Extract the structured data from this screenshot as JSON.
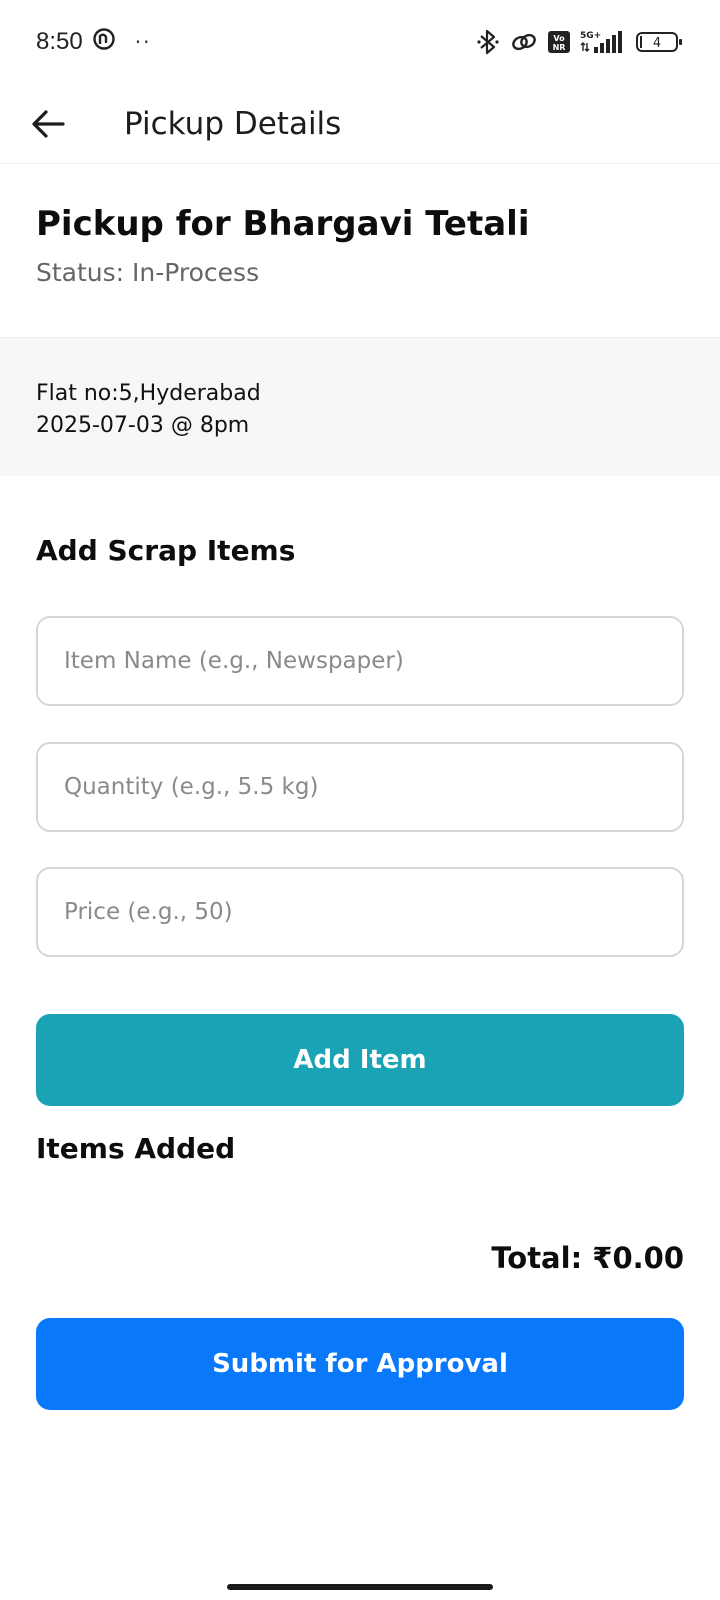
{
  "status_bar": {
    "time": "8:50",
    "dots": "··",
    "network_label": "5G+",
    "volte_label": "VoNR",
    "battery_level": "4"
  },
  "app_bar": {
    "title": "Pickup Details",
    "back_icon": "arrow-left-icon"
  },
  "pickup": {
    "title": "Pickup for Bhargavi Tetali",
    "status": "Status: In-Process",
    "address": "Flat no:5,Hyderabad",
    "schedule": "2025-07-03 @ 8pm"
  },
  "form": {
    "section_title": "Add Scrap Items",
    "item_name_placeholder": "Item Name (e.g., Newspaper)",
    "quantity_placeholder": "Quantity (e.g., 5.5 kg)",
    "price_placeholder": "Price (e.g., 50)",
    "add_button_label": "Add Item"
  },
  "items": {
    "section_title": "Items Added",
    "total": "Total: ₹0.00"
  },
  "submit_button_label": "Submit for Approval",
  "colors": {
    "add_button": "#19a3b5",
    "submit_button": "#0a78fb"
  }
}
